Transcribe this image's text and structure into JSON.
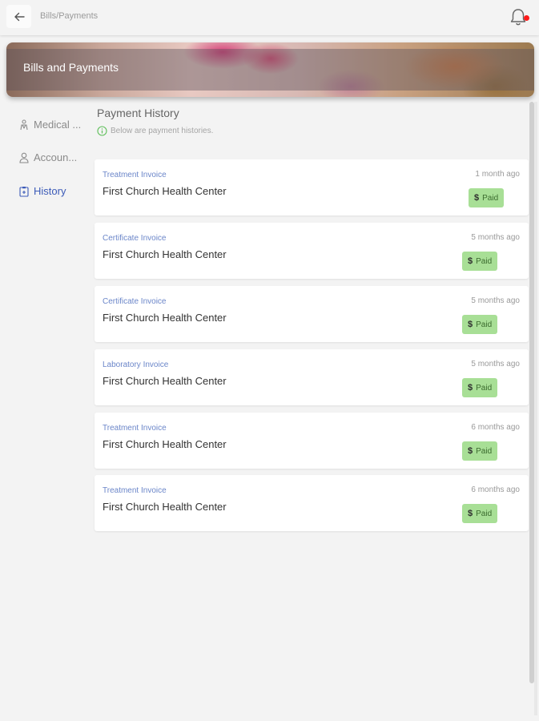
{
  "topbar": {
    "breadcrumb": "Bills/Payments",
    "notification_dot_color": "#ff1a1a"
  },
  "banner": {
    "title": "Bills and Payments"
  },
  "sidebar": {
    "items": [
      {
        "label": "Medical ...",
        "icon": "medical-icon",
        "active": false
      },
      {
        "label": "Accoun...",
        "icon": "user-icon",
        "active": false
      },
      {
        "label": "History",
        "icon": "history-icon",
        "active": true
      }
    ],
    "active_color": "#3c5bb8"
  },
  "main": {
    "title": "Payment History",
    "subtitle": "Below are payment histories.",
    "payments": [
      {
        "type": "Treatment Invoice",
        "facility": "First Church Health Center",
        "time": "1 month ago",
        "status": "Paid"
      },
      {
        "type": "Certificate Invoice",
        "facility": "First Church Health Center",
        "time": "5 months ago",
        "status": "Paid"
      },
      {
        "type": "Certificate Invoice",
        "facility": "First Church Health Center",
        "time": "5 months ago",
        "status": "Paid"
      },
      {
        "type": "Laboratory Invoice",
        "facility": "First Church Health Center",
        "time": "5 months ago",
        "status": "Paid"
      },
      {
        "type": "Treatment Invoice",
        "facility": "First Church Health Center",
        "time": "6 months ago",
        "status": "Paid"
      },
      {
        "type": "Treatment Invoice",
        "facility": "First Church Health Center",
        "time": "6 months ago",
        "status": "Paid"
      }
    ],
    "status_color": "#a8df96",
    "type_color": "#6b86c9"
  }
}
